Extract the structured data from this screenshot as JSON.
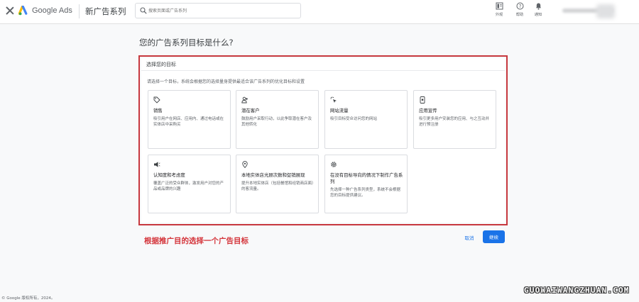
{
  "header": {
    "brand": "Google Ads",
    "page_title": "新广告系列",
    "search_placeholder": "搜索页面或广告系列",
    "buttons": [
      {
        "label": "外观",
        "icon": "appearance-icon"
      },
      {
        "label": "帮助",
        "icon": "help-icon"
      },
      {
        "label": "通知",
        "icon": "bell-icon"
      }
    ],
    "brand_colors": [
      "#4285f4",
      "#fbbc04",
      "#34a853"
    ]
  },
  "main": {
    "question": "您的广告系列目标是什么?",
    "panel": {
      "title": "选择您的目标",
      "description": "请选择一个目标，系统会根据您的选择量身提供最适合该广告系列的优化目标和设置"
    },
    "goals": [
      {
        "icon": "tag-icon",
        "title": "销售",
        "desc": "吸引用户在网店、应用内、通过电话或在实体店中采购买"
      },
      {
        "icon": "users-icon",
        "title": "潜在客户",
        "desc": "鼓励用户采取行动，以此争取潜在客户及其他转化"
      },
      {
        "icon": "cursor-click-icon",
        "title": "网站流量",
        "desc": "吸引目标受众访问您的网站"
      },
      {
        "icon": "phone-app-icon",
        "title": "应用宣传",
        "desc": "吸引更多用户安装您的应用、与之互动并进行预注册"
      },
      {
        "icon": "megaphone-icon",
        "title": "认知度和考虑度",
        "desc": "覆盖广泛的受众群体，激发用户对您的产品或品牌的兴趣"
      },
      {
        "icon": "location-pin-icon",
        "title": "本地实体店光顾次数和促销展现",
        "desc": "提升本地实体店（包括餐馆和经销商店面）的客流量。"
      },
      {
        "icon": "gear-icon",
        "title": "在没有目标导向的情况下制作广告系列",
        "desc": "先选择一种广告系列类型，系统不会根据您的目标提供建议。"
      }
    ],
    "annotation": "根据推广目的选择一个广告目标",
    "cancel_label": "取消",
    "continue_label": "继续",
    "accent_color": "#1a73e8",
    "highlight_color": "#c7383e"
  },
  "footer": {
    "copyright": "© Google 版权所有，2024。",
    "watermark": "GUOWAIWANGZHUAN.COM"
  }
}
